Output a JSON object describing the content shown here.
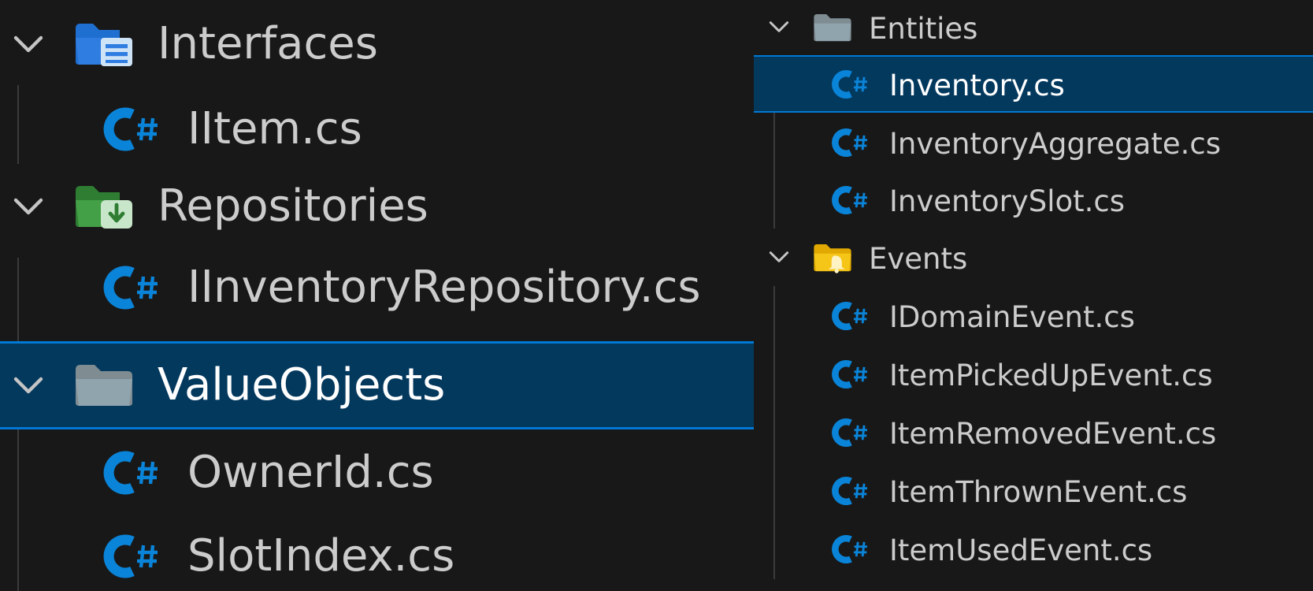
{
  "colors": {
    "background": "#181818",
    "text": "#cccccc",
    "selection_bg": "#04395e",
    "selection_border": "#0078d4",
    "csharp_icon": "#0a84d8",
    "folder_gray": "#90a4ae",
    "folder_blue": "#2f7de1",
    "folder_green": "#43a047",
    "folder_yellow": "#f5c518"
  },
  "left_tree": {
    "interfaces": {
      "label": "Interfaces",
      "icon": "interfaces-folder-icon",
      "expanded": true,
      "files": [
        {
          "label": "IItem.cs",
          "icon": "csharp-file-icon"
        }
      ]
    },
    "repositories": {
      "label": "Repositories",
      "icon": "repository-folder-icon",
      "expanded": true,
      "files": [
        {
          "label": "IInventoryRepository.cs",
          "icon": "csharp-file-icon"
        }
      ]
    },
    "value_objects": {
      "label": "ValueObjects",
      "icon": "folder-open-icon",
      "expanded": true,
      "selected": true,
      "files": [
        {
          "label": "OwnerId.cs",
          "icon": "csharp-file-icon"
        },
        {
          "label": "SlotIndex.cs",
          "icon": "csharp-file-icon"
        }
      ]
    }
  },
  "right_tree": {
    "entities": {
      "label": "Entities",
      "icon": "folder-open-icon",
      "expanded": true,
      "files": [
        {
          "label": "Inventory.cs",
          "icon": "csharp-file-icon",
          "selected": true
        },
        {
          "label": "InventoryAggregate.cs",
          "icon": "csharp-file-icon"
        },
        {
          "label": "InventorySlot.cs",
          "icon": "csharp-file-icon"
        }
      ]
    },
    "events": {
      "label": "Events",
      "icon": "events-folder-icon",
      "expanded": true,
      "files": [
        {
          "label": "IDomainEvent.cs",
          "icon": "csharp-file-icon"
        },
        {
          "label": "ItemPickedUpEvent.cs",
          "icon": "csharp-file-icon"
        },
        {
          "label": "ItemRemovedEvent.cs",
          "icon": "csharp-file-icon"
        },
        {
          "label": "ItemThrownEvent.cs",
          "icon": "csharp-file-icon"
        },
        {
          "label": "ItemUsedEvent.cs",
          "icon": "csharp-file-icon"
        }
      ]
    }
  }
}
